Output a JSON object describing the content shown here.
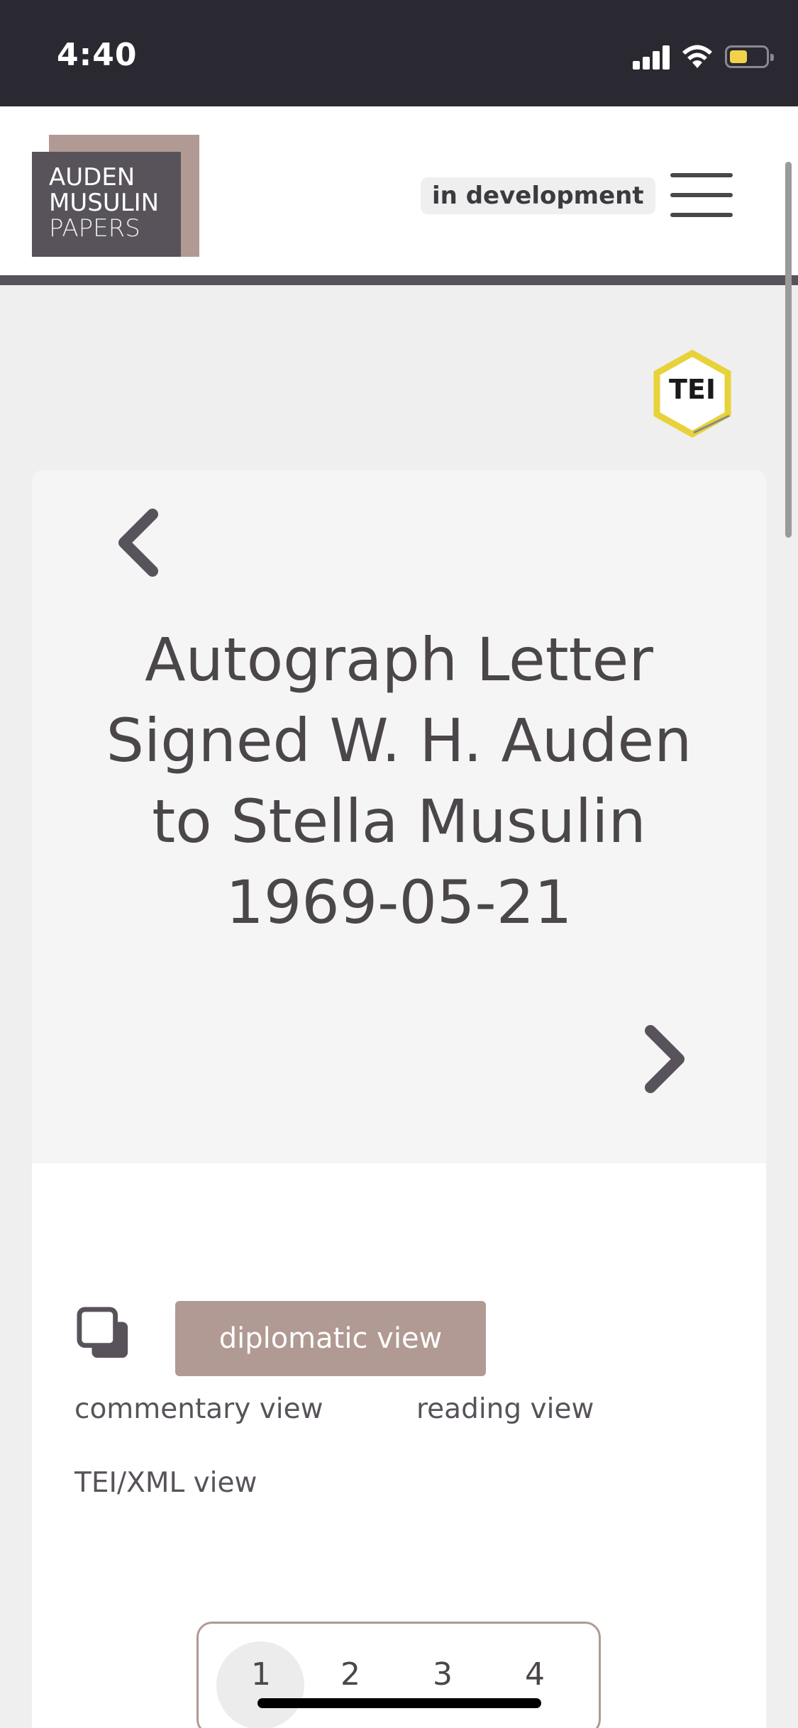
{
  "status_bar": {
    "time": "4:40"
  },
  "header": {
    "logo": {
      "line1": "AUDEN",
      "line2": "MUSULIN",
      "line3": "PAPERS"
    },
    "badge": "in development",
    "menu_icon": "hamburger-menu-icon"
  },
  "tei_badge": {
    "text": "TEI"
  },
  "document": {
    "title": "Autograph Letter Signed W. H. Auden to Stella Musulin 1969-05-21",
    "prev_icon": "chevron-left-icon",
    "next_icon": "chevron-right-icon"
  },
  "views": {
    "icon": "copy-icon",
    "items": [
      {
        "label": "diplomatic view",
        "active": true
      },
      {
        "label": "commentary view",
        "active": false
      },
      {
        "label": "reading view",
        "active": false
      },
      {
        "label": "TEI/XML view",
        "active": false
      }
    ]
  },
  "pager": {
    "pages": [
      "1",
      "2",
      "3",
      "4"
    ],
    "current": "1"
  },
  "colors": {
    "accent": "#b09a93",
    "dark": "#58535a",
    "status_bar": "#2a2830",
    "page_bg": "#efefef",
    "tei_yellow": "#e8d23a"
  }
}
